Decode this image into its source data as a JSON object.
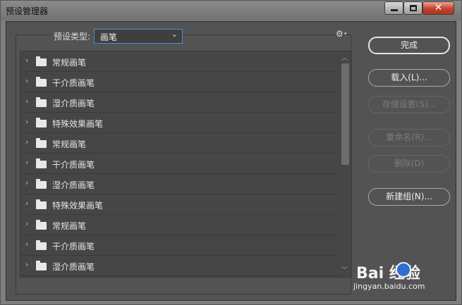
{
  "window": {
    "title": "预设管理器",
    "close_glyph": "✕"
  },
  "toolbar": {
    "preset_type_label": "预设类型:",
    "preset_type_value": "画笔",
    "chevron_glyph": "⌄",
    "gear_glyph": "⚙",
    "gear_caret": "▾"
  },
  "list": {
    "items": [
      {
        "label": "常规画笔"
      },
      {
        "label": "干介质画笔"
      },
      {
        "label": "湿介质画笔"
      },
      {
        "label": "特殊效果画笔"
      },
      {
        "label": "常规画笔"
      },
      {
        "label": "干介质画笔"
      },
      {
        "label": "湿介质画笔"
      },
      {
        "label": "特殊效果画笔"
      },
      {
        "label": "常规画笔"
      },
      {
        "label": "干介质画笔"
      },
      {
        "label": "湿介质画笔"
      }
    ],
    "expand_glyph": "›",
    "scroll_up_glyph": "︿",
    "scroll_down_glyph": "﹀"
  },
  "buttons": {
    "done": "完成",
    "load": "载入(L)...",
    "save_set": "存储设置(S)...",
    "rename": "重命名(R)...",
    "delete": "删除(D)",
    "new_group": "新建组(N)..."
  },
  "watermark": {
    "logo_text": "Bai  经验",
    "url": "jingyan.baidu.com"
  },
  "colors": {
    "accent": "#4a8fd6",
    "close_button": "#c2412d"
  }
}
